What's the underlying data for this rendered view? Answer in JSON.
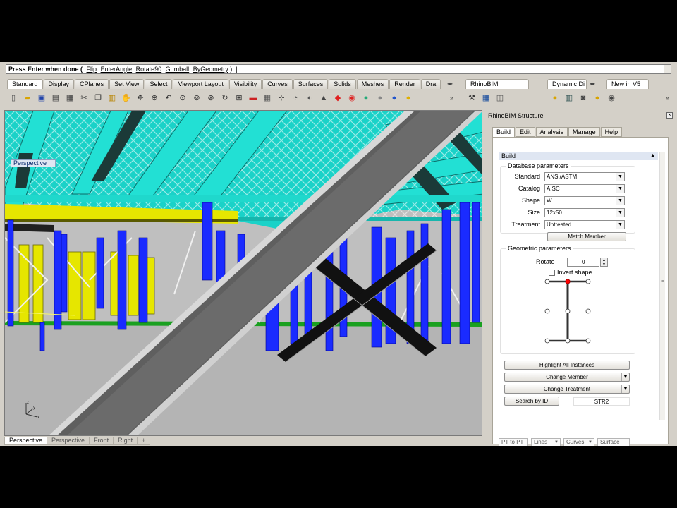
{
  "command_line": {
    "prompt": "Press Enter when done (",
    "options": [
      "Flip",
      "EnterAngle",
      "Rotate90",
      "Gumball",
      "ByGeometry"
    ],
    "suffix": "):"
  },
  "toolbar_tabs": [
    "Standard",
    "Display",
    "CPlanes",
    "Set View",
    "Select",
    "Viewport Layout",
    "Visibility",
    "Curves",
    "Surfaces",
    "Solids",
    "Meshes",
    "Render",
    "Dra"
  ],
  "rhinobim_tab": "RhinoBIM",
  "dynamic_tab": "Dynamic Di",
  "new_tab": "New in V5",
  "toolbar_icons": [
    "new-file-icon",
    "open-icon",
    "save-icon",
    "print-icon",
    "properties-icon",
    "cut-icon",
    "copy-icon",
    "paste-icon",
    "pan-icon",
    "move-icon",
    "zoom-icon",
    "undo-icon",
    "zoom-window-icon",
    "zoom-extents-icon",
    "zoom-selected-icon",
    "rotate-view-icon",
    "four-viewports-icon",
    "car-icon",
    "grid-icon",
    "points-icon",
    "analyze-icon",
    "hide-icon",
    "lock-icon",
    "layers-icon",
    "color-wheel-icon",
    "shade-icon",
    "render-sphere-icon",
    "material-icon",
    "bulb-icon"
  ],
  "viewport": {
    "title": "Perspective",
    "tabs": [
      "Perspective",
      "Perspective",
      "Front",
      "Right"
    ]
  },
  "panel": {
    "title": "RhinoBIM Structure",
    "tabs": [
      "Build",
      "Edit",
      "Analysis",
      "Manage",
      "Help"
    ],
    "section": "Build",
    "database": {
      "title": "Database parameters",
      "fields": [
        {
          "label": "Standard",
          "value": "ANSI/ASTM"
        },
        {
          "label": "Catalog",
          "value": "AISC"
        },
        {
          "label": "Shape",
          "value": "W"
        },
        {
          "label": "Size",
          "value": "12x50"
        },
        {
          "label": "Treatment",
          "value": "Untreated"
        }
      ],
      "match_button": "Match Member"
    },
    "geometric": {
      "title": "Geometric parameters",
      "rotate_label": "Rotate",
      "rotate_value": "0",
      "invert_label": "Invert shape"
    },
    "buttons": {
      "highlight": "Highlight All Instances",
      "change_member": "Change Member",
      "change_treatment": "Change Treatment",
      "search": "Search by ID",
      "search_value": "STR2"
    },
    "bottom": [
      "PT to PT",
      "Lines",
      "Curves",
      "Surface"
    ]
  },
  "colors": {
    "cyan_steel": "#19d2c8",
    "blue_columns": "#1a2bff",
    "yellow_deck": "#e6e600",
    "accent_point": "#ff0000"
  }
}
